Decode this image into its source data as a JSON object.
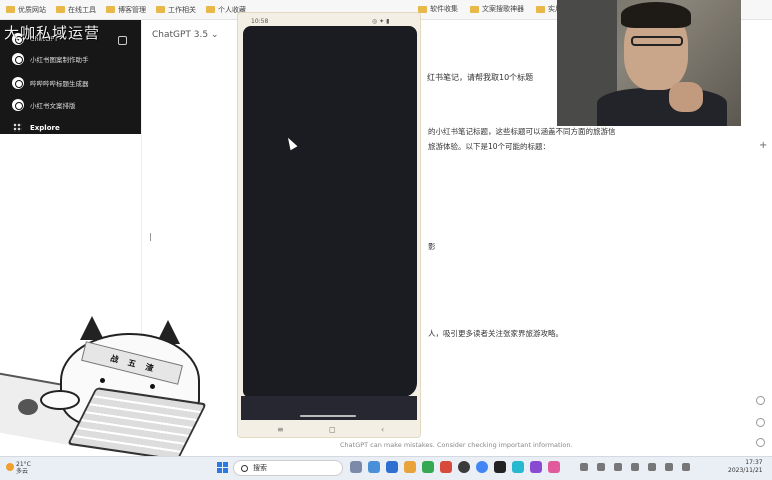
{
  "bookmarks": {
    "left": [
      "优质网站",
      "在线工具",
      "博客管理",
      "工作相关",
      "个人收藏"
    ],
    "right": [
      "软件收集",
      "文案搜歌神器",
      "实用"
    ]
  },
  "sidebar": {
    "brand_overlay": "大咖私域运营",
    "items": [
      "ChatGPT",
      "小红书图案制作助手",
      "哔哔哔哔标题生成器",
      "小红书文案排版"
    ],
    "explore": "Explore"
  },
  "main": {
    "model": "ChatGPT 3.5",
    "lines": [
      "红书笔记，请帮我取10个标题",
      "的小红书笔记标题，这些标题可以涵盖不同方面的旅游信",
      "旅游体验。以下是10个可能的标题：",
      "人，吸引更多读者关注张家界旅游攻略。"
    ],
    "partial_fragment": "影",
    "disclaimer": "ChatGPT can make mistakes. Consider checking important information."
  },
  "phone": {
    "status_left": "10:58",
    "status_right": "◎ ✦ ▮",
    "nav_keys": [
      "≡",
      "◻",
      "‹"
    ]
  },
  "mascot": {
    "headband_text": [
      "战",
      "五",
      "渣"
    ]
  },
  "taskbar": {
    "weather_temp": "21°C",
    "weather_desc": "多云",
    "search_placeholder": "搜索",
    "time": "17:37",
    "date": "2023/11/21"
  }
}
